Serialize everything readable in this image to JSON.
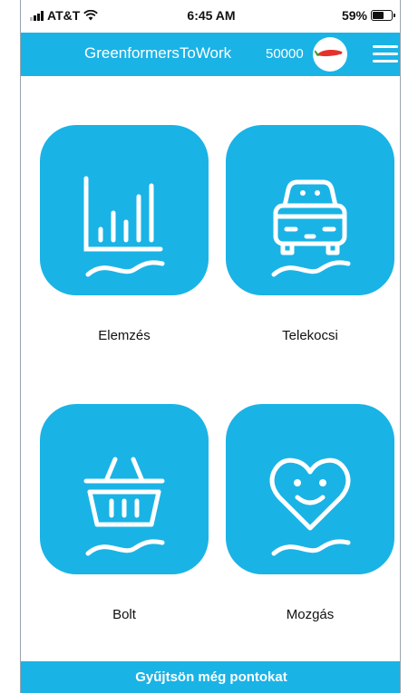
{
  "status_bar": {
    "carrier": "AT&T",
    "time": "6:45 AM",
    "battery_percent": "59%",
    "battery_level": 0.59
  },
  "header": {
    "title": "GreenformersToWork",
    "points": "50000",
    "points_icon": "chili-pepper-icon",
    "menu_icon": "hamburger-menu-icon"
  },
  "tiles": [
    {
      "label": "Elemzés",
      "icon": "bar-chart-icon"
    },
    {
      "label": "Telekocsi",
      "icon": "car-icon"
    },
    {
      "label": "Bolt",
      "icon": "shopping-basket-icon"
    },
    {
      "label": "Mozgás",
      "icon": "heart-smile-icon"
    }
  ],
  "bottom_banner": {
    "text": "Gyűjtsön még pontokat"
  },
  "colors": {
    "accent": "#1ab3e6",
    "background": "#ffffff",
    "text": "#111111"
  }
}
